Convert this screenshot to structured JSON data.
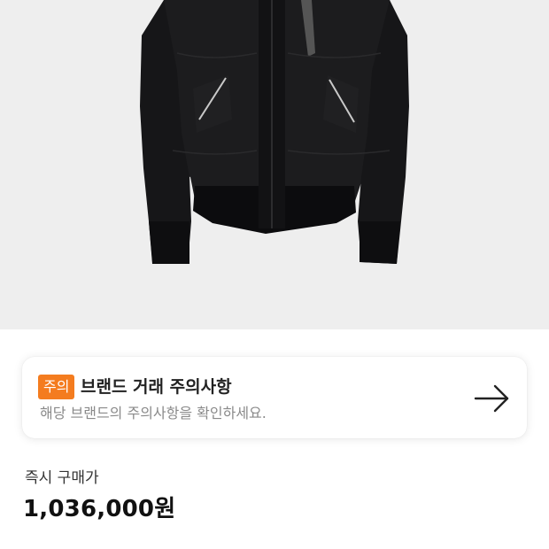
{
  "product": {
    "image_alt": "black bomber jacket"
  },
  "notice": {
    "badge": "주의",
    "title": "브랜드 거래 주의사항",
    "description": "해당 브랜드의 주의사항을 확인하세요.",
    "arrow_icon": "arrow-right-icon",
    "badge_color": "#f47c1f"
  },
  "price": {
    "label": "즉시 구매가",
    "value": "1,036,000원"
  }
}
